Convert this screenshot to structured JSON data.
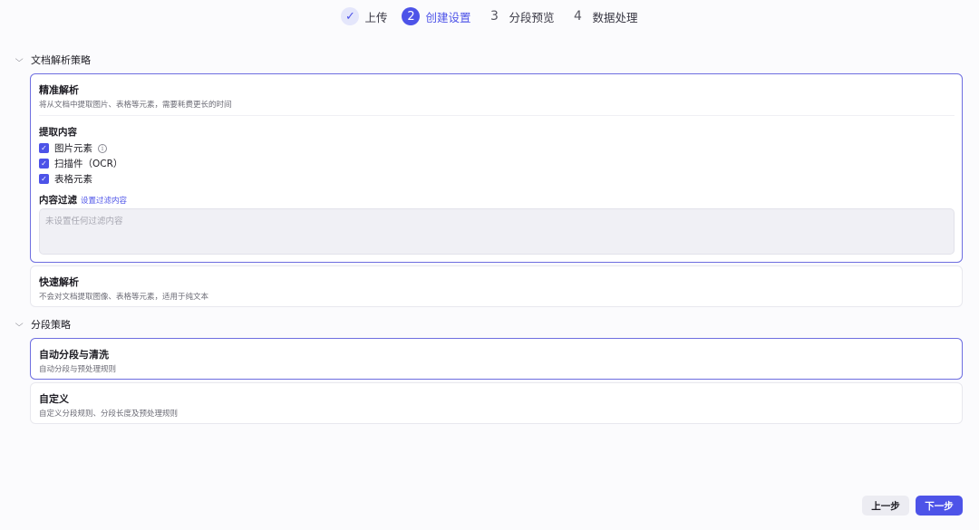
{
  "stepper": {
    "steps": [
      {
        "badge": "✓",
        "label": "上传",
        "state": "done"
      },
      {
        "badge": "2",
        "label": "创建设置",
        "state": "active"
      },
      {
        "badge": "3",
        "label": "分段预览",
        "state": "todo"
      },
      {
        "badge": "4",
        "label": "数据处理",
        "state": "todo"
      }
    ]
  },
  "parse_section": {
    "title": "文档解析策略",
    "precise": {
      "title": "精准解析",
      "desc": "将从文档中提取图片、表格等元素，需要耗费更长的时间",
      "extract_title": "提取内容",
      "options": [
        {
          "label": "图片元素",
          "checked": true,
          "has_info": true
        },
        {
          "label": "扫描件（OCR）",
          "checked": true
        },
        {
          "label": "表格元素",
          "checked": true
        }
      ],
      "filter_title": "内容过滤",
      "filter_link": "设置过滤内容",
      "filter_placeholder": "未设置任何过滤内容"
    },
    "fast": {
      "title": "快速解析",
      "desc": "不会对文档提取图像、表格等元素，适用于纯文本"
    }
  },
  "segment_section": {
    "title": "分段策略",
    "auto": {
      "title": "自动分段与清洗",
      "desc": "自动分段与预处理规则"
    },
    "custom": {
      "title": "自定义",
      "desc": "自定义分段规则、分段长度及预处理规则"
    }
  },
  "footer": {
    "prev_label": "上一步",
    "next_label": "下一步"
  },
  "colors": {
    "accent": "#4d53e8",
    "selected_border": "#6e6ee0",
    "background": "#fbfbfd"
  }
}
